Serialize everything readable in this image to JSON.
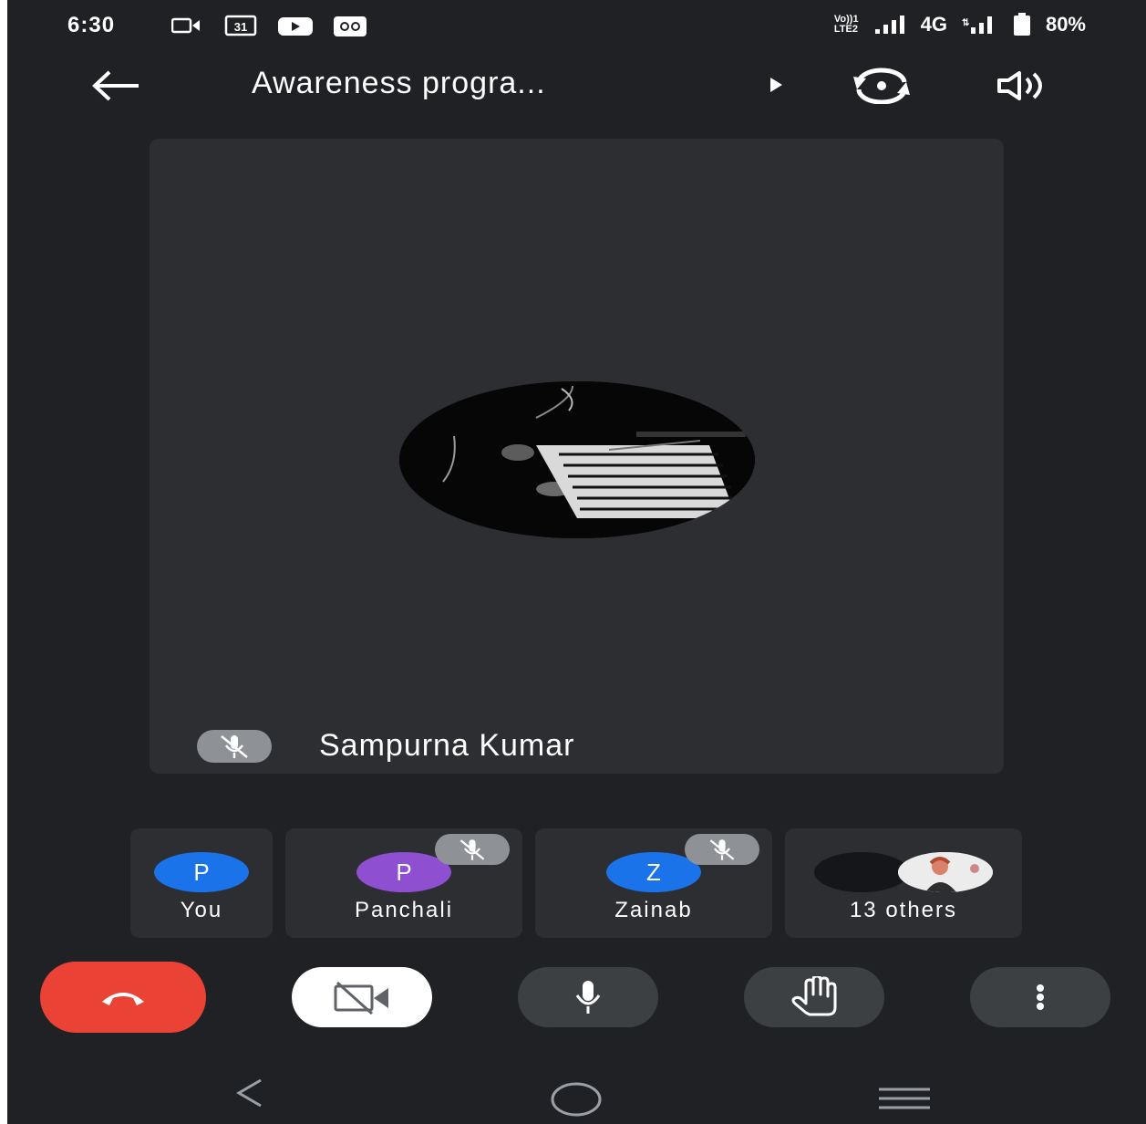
{
  "status_bar": {
    "time": "6:30",
    "network_type": "4G",
    "battery": "80%",
    "lte_label_top": "Vo))1",
    "lte_label_bottom": "LTE2",
    "calendar_day": "31"
  },
  "header": {
    "title": "Awareness progra...",
    "icons": [
      "back-arrow-icon",
      "play-caret-icon",
      "switch-camera-icon",
      "speaker-icon"
    ]
  },
  "main_tile": {
    "participant_name": "Sampurna Kumar",
    "muted": true
  },
  "participants": [
    {
      "name": "You",
      "initial": "P",
      "color": "#1a73e8",
      "muted": false
    },
    {
      "name": "Panchali",
      "initial": "P",
      "color": "#8e4fd0",
      "muted": true
    },
    {
      "name": "Zainab",
      "initial": "Z",
      "color": "#1a73e8",
      "muted": true
    },
    {
      "name": "13 others",
      "initial": "",
      "color": "#14161a",
      "muted": false
    }
  ],
  "controls": [
    {
      "name": "end-call",
      "color": "#ea4335"
    },
    {
      "name": "camera-off",
      "color": "#ffffff"
    },
    {
      "name": "microphone",
      "color": "#3c4043"
    },
    {
      "name": "raise-hand",
      "color": "#3c4043"
    },
    {
      "name": "more-options",
      "color": "#3c4043"
    }
  ],
  "colors": {
    "background": "#202124",
    "tile": "#2d2e31",
    "accent_blue": "#1a73e8",
    "end_call_red": "#ea4335"
  }
}
